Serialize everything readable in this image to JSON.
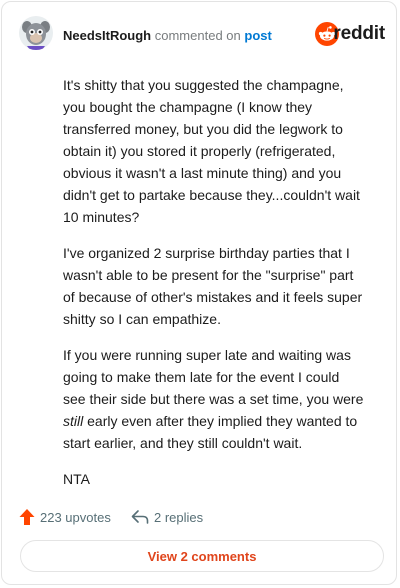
{
  "comment": {
    "author": "NeedsItRough",
    "verb": "commented on",
    "link_text": "post",
    "paragraphs": [
      "It's shitty that you suggested the champagne, you bought the champagne (I know they transferred money, but you did the legwork to obtain it) you stored it properly (refrigerated, obvious it wasn't a last minute thing) and you didn't get to partake because they...couldn't wait 10 minutes?",
      "I've organized 2 surprise birthday parties that I wasn't able to be present for the \"surprise\" part of because of other's mistakes and it feels super shitty so I can empathize.",
      {
        "before": "If you were running super late and waiting was going to make them late for the event I could see their side but there was a set time, you were ",
        "emphasis": "still",
        "after": " early even after they implied they wanted to start earlier, and they still couldn't wait."
      },
      "NTA"
    ]
  },
  "brand": {
    "wordmark": "reddit",
    "color": "#ff4500"
  },
  "stats": {
    "upvotes": "223 upvotes",
    "replies": "2 replies"
  },
  "actions": {
    "view_comments": "View 2 comments"
  },
  "icons": {
    "upvote": "upvote-arrow-icon",
    "reply": "reply-arrow-icon",
    "logo": "reddit-alien-icon"
  }
}
